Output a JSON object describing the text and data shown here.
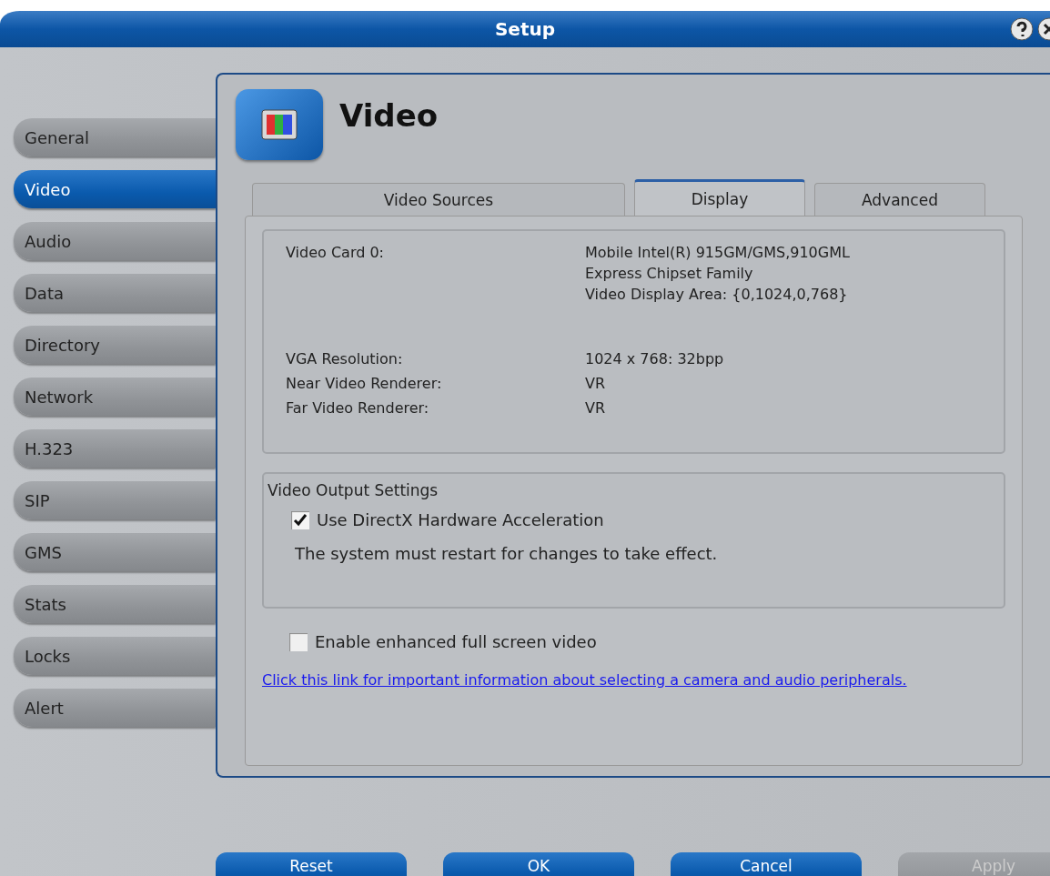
{
  "window": {
    "title": "Setup"
  },
  "sidebar": {
    "items": [
      {
        "label": "General",
        "selected": false
      },
      {
        "label": "Video",
        "selected": true
      },
      {
        "label": "Audio",
        "selected": false
      },
      {
        "label": "Data",
        "selected": false
      },
      {
        "label": "Directory",
        "selected": false
      },
      {
        "label": "Network",
        "selected": false
      },
      {
        "label": "H.323",
        "selected": false
      },
      {
        "label": "SIP",
        "selected": false
      },
      {
        "label": "GMS",
        "selected": false
      },
      {
        "label": "Stats",
        "selected": false
      },
      {
        "label": "Locks",
        "selected": false
      },
      {
        "label": "Alert",
        "selected": false
      }
    ]
  },
  "panel": {
    "title": "Video",
    "tabs": [
      {
        "label": "Video Sources",
        "selected": false
      },
      {
        "label": "Display",
        "selected": true
      },
      {
        "label": "Advanced",
        "selected": false
      }
    ],
    "info": [
      {
        "label": "Video Card 0:",
        "values": [
          "Mobile Intel(R) 915GM/GMS,910GML",
          "Express Chipset Family",
          "Video Display Area:  {0,1024,0,768}"
        ]
      },
      {
        "label": "VGA Resolution:",
        "values": [
          "1024 x 768: 32bpp"
        ]
      },
      {
        "label": "Near Video Renderer:",
        "values": [
          "VR"
        ]
      },
      {
        "label": "Far Video Renderer:",
        "values": [
          "VR"
        ]
      }
    ],
    "output_settings": {
      "title": "Video Output Settings",
      "checkbox": {
        "label": "Use DirectX Hardware Acceleration",
        "checked": true
      },
      "note": "The system must restart for changes to take effect."
    },
    "fullscreen_checkbox": {
      "label": "Enable enhanced full screen video",
      "checked": false
    },
    "link": "Click this link for important information about selecting a camera and audio peripherals."
  },
  "buttons": [
    {
      "label": "Reset",
      "disabled": false
    },
    {
      "label": "OK",
      "disabled": false
    },
    {
      "label": "Cancel",
      "disabled": false
    },
    {
      "label": "Apply",
      "disabled": true
    }
  ]
}
